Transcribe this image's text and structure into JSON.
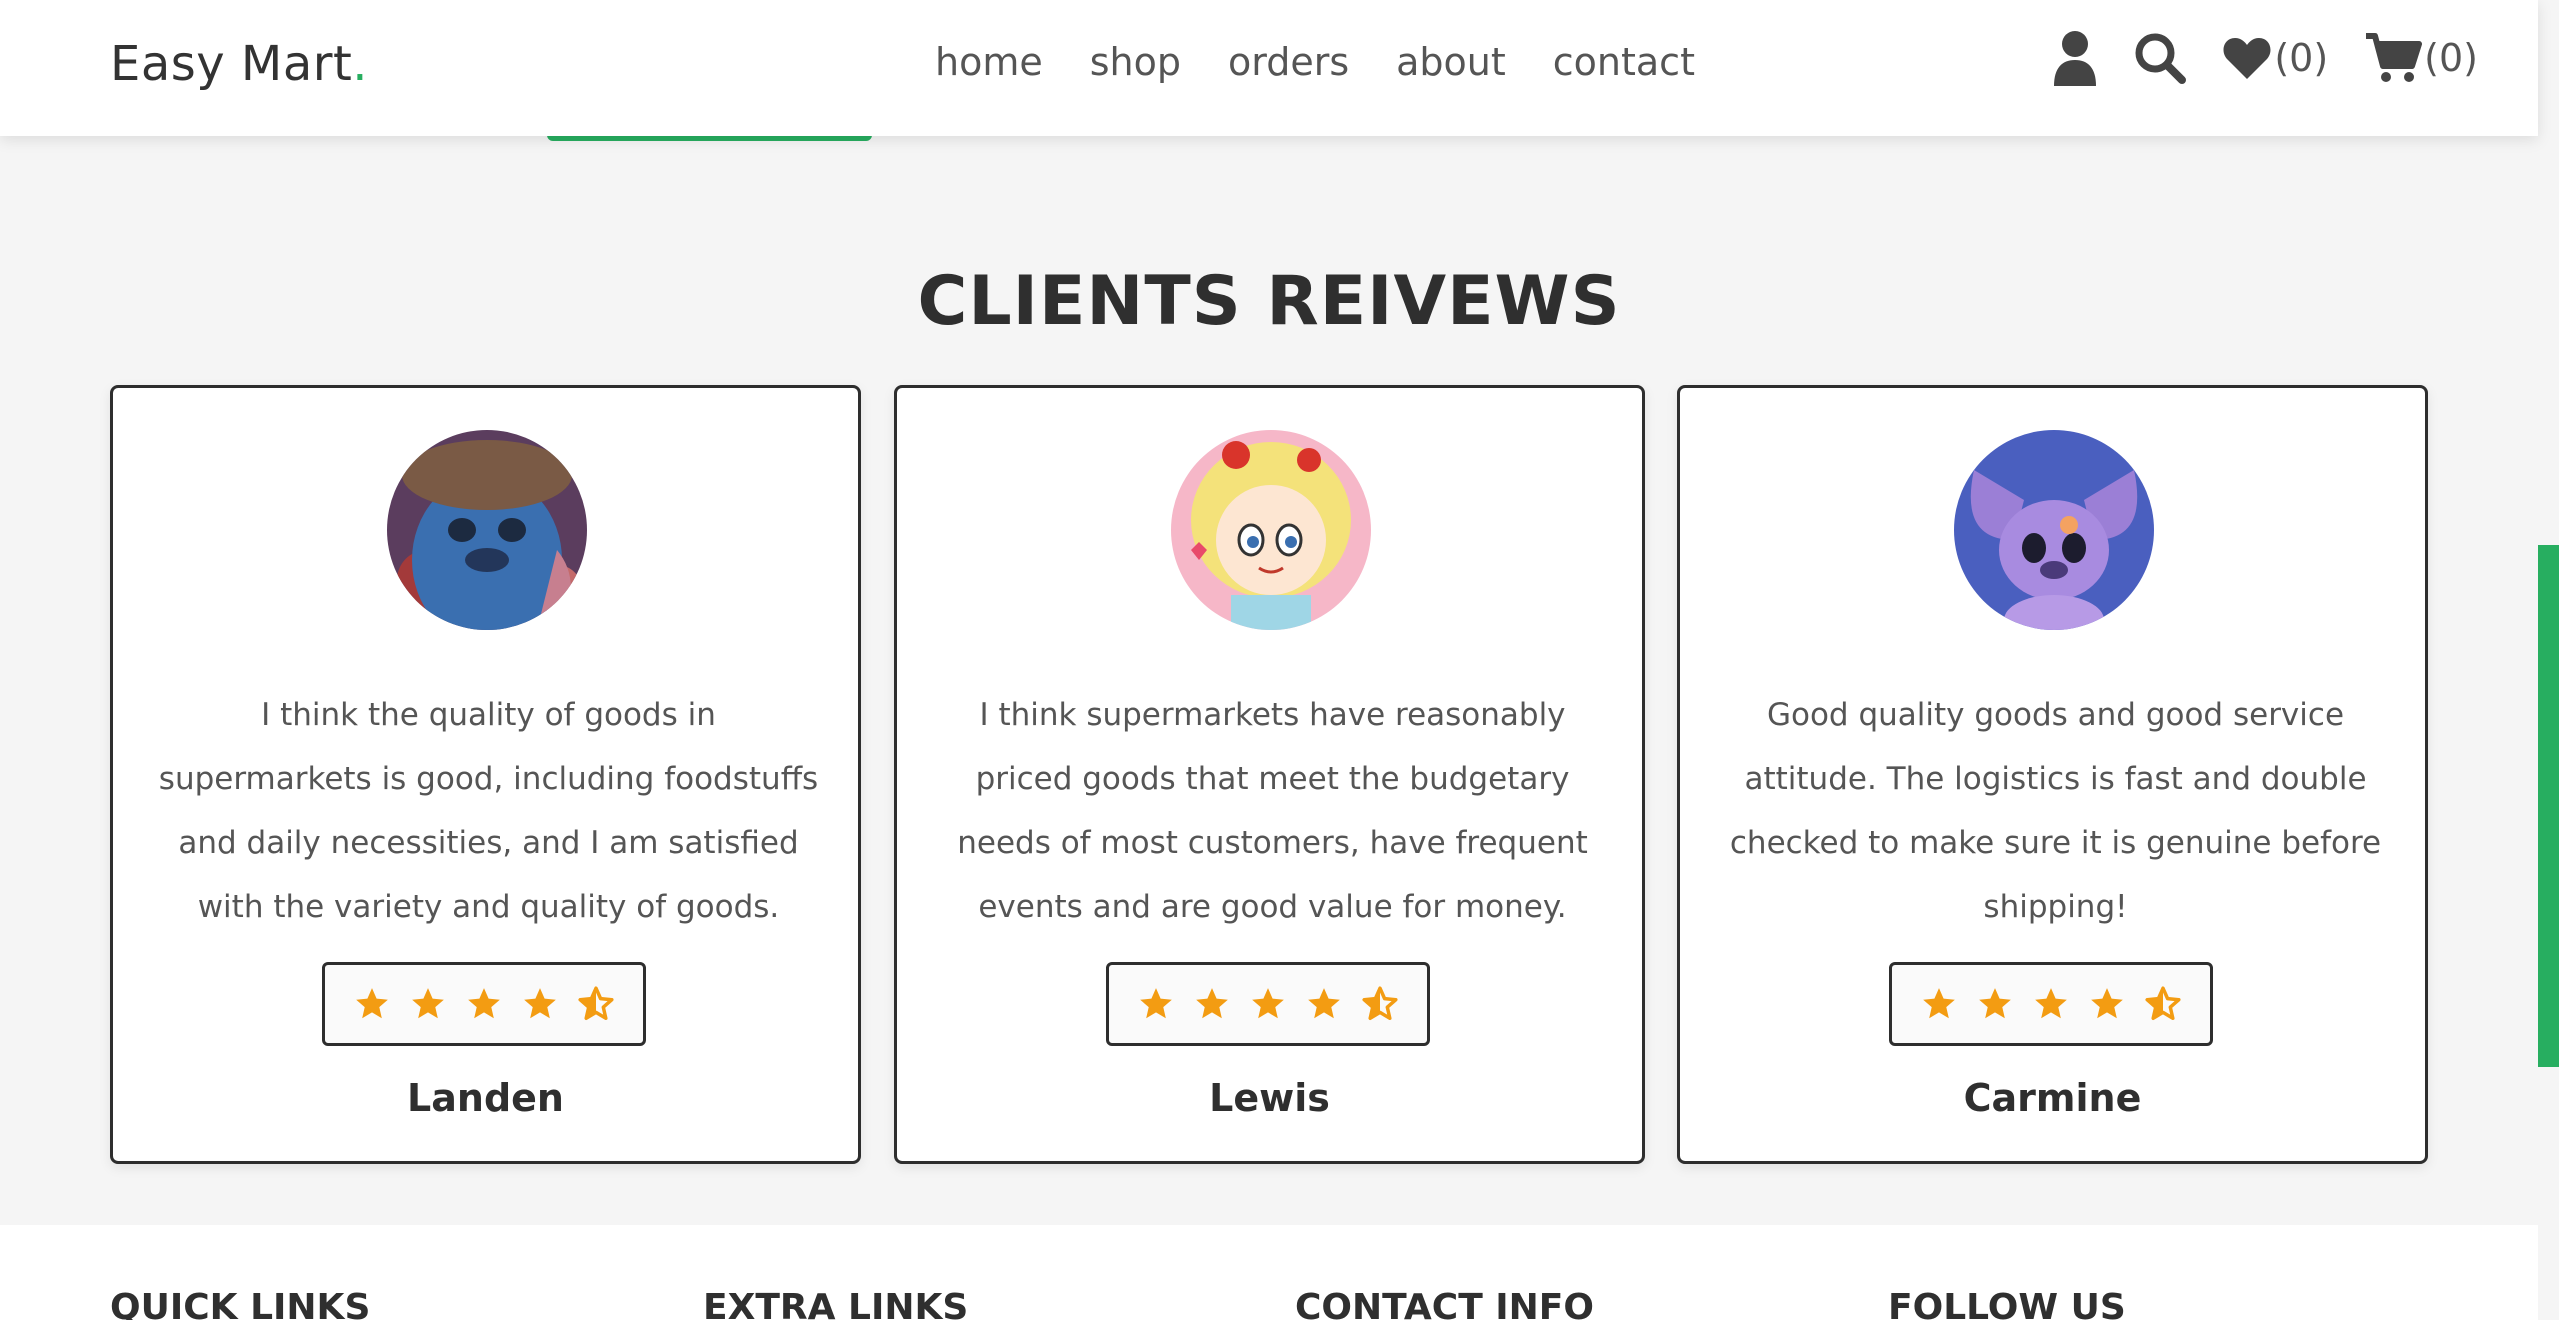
{
  "header": {
    "logo_text": "Easy Mart",
    "logo_dot": ".",
    "nav": [
      "home",
      "shop",
      "orders",
      "about",
      "contact"
    ],
    "wishlist_count": "(0)",
    "cart_count": "(0)",
    "icons": [
      "user-icon",
      "search-icon",
      "heart-icon",
      "cart-icon"
    ]
  },
  "reviews": {
    "title": "CLIENTS REIVEWS",
    "items": [
      {
        "text": "I think the quality of goods in supermarkets is good, including foodstuffs and daily necessities, and I am satisfied with the variety and quality of goods.",
        "rating": 4.5,
        "name": "Landen"
      },
      {
        "text": "I think supermarkets have reasonably priced goods that meet the budgetary needs of most customers, have frequent events and are good value for money.",
        "rating": 4.5,
        "name": "Lewis"
      },
      {
        "text": "Good quality goods and good service attitude. The logistics is fast and double checked to make sure it is genuine before shipping!",
        "rating": 4.5,
        "name": "Carmine"
      }
    ]
  },
  "footer": {
    "columns": [
      "QUICK LINKS",
      "EXTRA LINKS",
      "CONTACT INFO",
      "FOLLOW US"
    ]
  },
  "colors": {
    "accent": "#27ae60",
    "star": "#f39c12",
    "text": "#333333"
  }
}
